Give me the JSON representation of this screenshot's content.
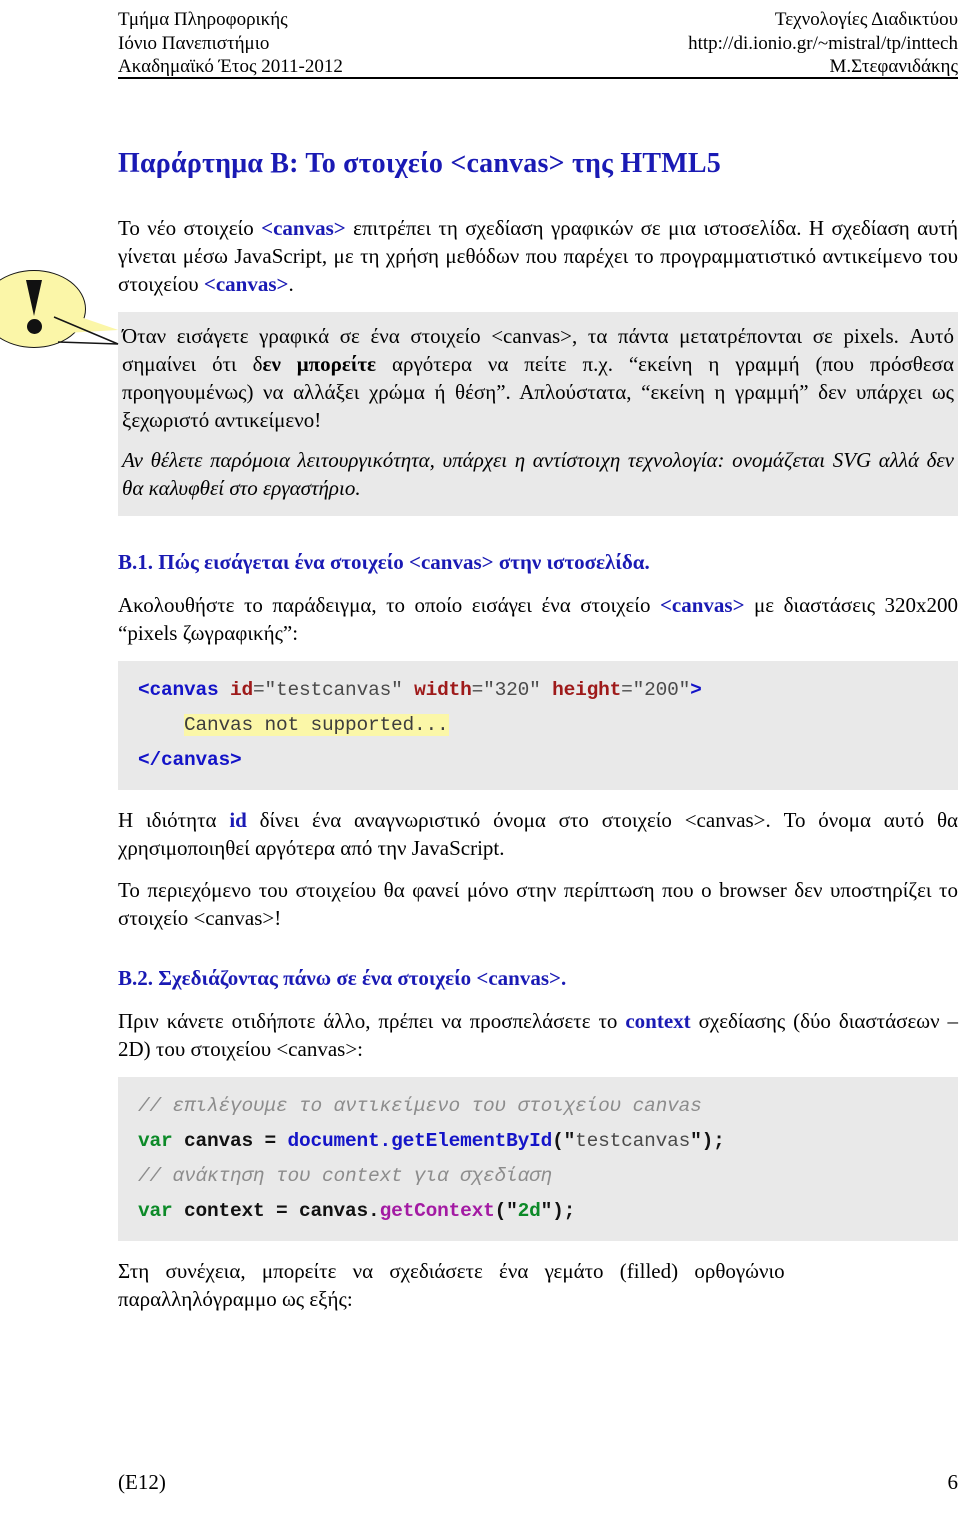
{
  "header": {
    "left_lines": [
      "Τμήμα Πληροφορικής",
      "Ιόνιο Πανεπιστήμιο",
      "Ακαδημαϊκό Έτος 2011-2012"
    ],
    "right_lines": [
      "Τεχνολογίες Διαδικτύου",
      "http://di.ionio.gr/~mistral/tp/inttech",
      "Μ.Στεφανιδάκης"
    ]
  },
  "title": "Παράρτημα Β: Το στοιχείο <canvas> της HTML5",
  "intro": {
    "p1_a": "Το νέο στοιχείο ",
    "p1_tag1": "<canvas>",
    "p1_b": " επιτρέπει τη σχεδίαση γραφικών σε μια ιστοσελίδα. Η σχεδίαση αυτή γίνεται μέσω JavaScript, με τη χρήση μεθόδων που παρέχει το προγραμματιστικό αντικείμενο του στοιχείου ",
    "p1_tag2": "<canvas>",
    "p1_c": "."
  },
  "callout": {
    "icon": "exclamation-bubble-icon",
    "p1_a": "Όταν εισάγετε γραφικά σε ένα στοιχείο <canvas>, τα πάντα μετατρέπονται σε pixels. Αυτό σημαίνει ότι δ",
    "p1_bold": "εν μπορείτε",
    "p1_b": " αργότερα να πείτε π.χ. “εκείνη η γραμμή (που πρόσθεσα προηγουμένως)  να αλλάξει χρώμα ή θέση”. Απλούστατα, “εκείνη η γραμμή” δεν υπάρχει ως ξεχωριστό αντικείμενο!",
    "p2_italic": "Αν θέλετε παρόμοια λειτουργικότητα, υπάρχει η αντίστοιχη τεχνολογία: ονομάζεται SVG αλλά δεν θα καλυφθεί στο εργαστήριο."
  },
  "section_b1": {
    "heading": "Β.1. Πώς εισάγεται ένα στοιχείο <canvas> στην ιστοσελίδα.",
    "p_a": "Ακολουθήστε το παράδειγμα, το οποίο εισάγει ένα στοιχείο ",
    "p_tag": "<canvas>",
    "p_b": " με διαστάσεις 320x200 “pixels ζωγραφικής”:"
  },
  "code_html": {
    "line1_tag_open": "<canvas",
    "line1_attr1": "id",
    "line1_val1": "=\"testcanvas\"",
    "line1_attr2": "width",
    "line1_val2": "=\"320\"",
    "line1_attr3": "height",
    "line1_val3": "=\"200\"",
    "line1_gt": ">",
    "line2_indent": "    ",
    "line2_text": "Canvas not supported...",
    "line3": "</canvas>"
  },
  "after_code": {
    "p1_a": "Η ιδιότητα ",
    "p1_id": "id",
    "p1_b": " δίνει ένα αναγνωριστικό όνομα στο στοιχείο <canvas>. Το όνομα αυτό θα χρησιμοποιηθεί αργότερα από την JavaScript.",
    "p2": "Το περιεχόμενο του στοιχείου θα φανεί μόνο στην περίπτωση που ο browser δεν υποστηρίζει το στοιχείο <canvas>!"
  },
  "section_b2": {
    "heading": "Β.2. Σχεδιάζοντας πάνω σε ένα στοιχείο <canvas>.",
    "p_a": "Πριν κάνετε οτιδήποτε άλλο, πρέπει να προσπελάσετε το ",
    "p_ctx": "context",
    "p_b": " σχεδίασης (δύο διαστάσεων – 2D) του στοιχείου <canvas>:"
  },
  "code_js": {
    "comment1": "// επιλέγουμε το αντικείμενο του στοιχείου canvas",
    "l2_kw": "var",
    "l2_id": " canvas = ",
    "l2_fn": "document.getElementById",
    "l2_open": "(\"",
    "l2_str": "testcanvas",
    "l2_close": "\");",
    "comment2": "// ανάκτηση του context για σχεδίαση",
    "l4_kw": "var",
    "l4_id": " context = canvas.",
    "l4_fn": "getContext",
    "l4_open": "(\"",
    "l4_str": "2d",
    "l4_close": "\");"
  },
  "closing": {
    "p_main": "Στη συνέχεια, μπορείτε να σχεδιάσετε ένα γεμάτο (filled) ορθογώνιο",
    "p_tail": "παραλληλόγραμμο ως εξής:"
  },
  "footer": {
    "left": "(E12)",
    "right": "6"
  },
  "colors": {
    "accent_blue": "#1a1ab4",
    "callout_bg": "#e9e9e9",
    "bubble_yellow": "#fbf6a8",
    "code_keyword_green": "#0c8a28",
    "code_attr_red": "#9e1a1a",
    "code_fn_purple": "#a31aa3",
    "highlight_yellow": "#fbf7a8"
  }
}
